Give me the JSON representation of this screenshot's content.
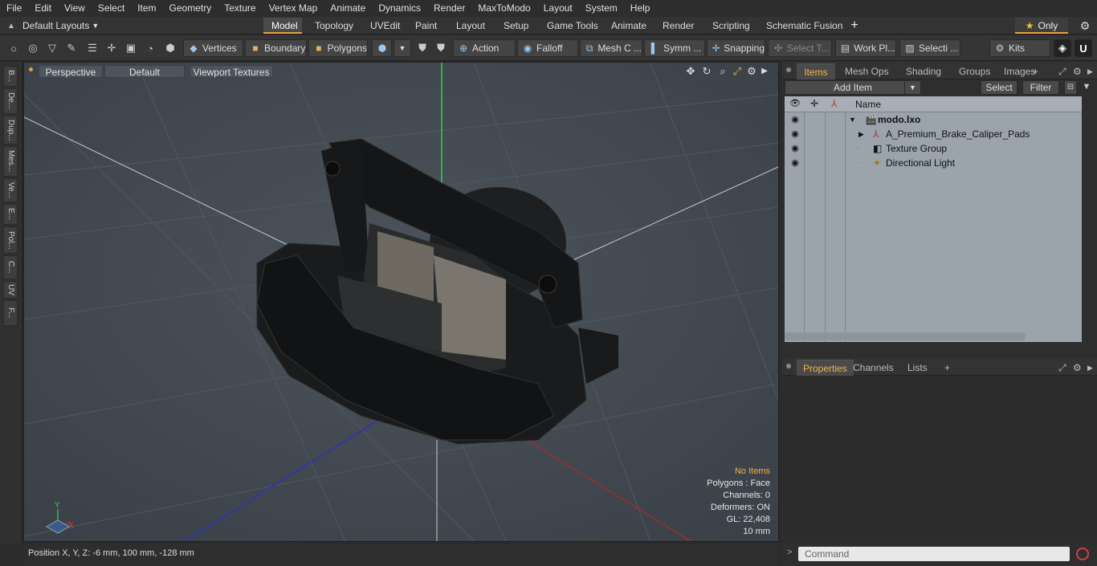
{
  "menu": [
    "File",
    "Edit",
    "View",
    "Select",
    "Item",
    "Geometry",
    "Texture",
    "Vertex Map",
    "Animate",
    "Dynamics",
    "Render",
    "MaxToModo",
    "Layout",
    "System",
    "Help"
  ],
  "layouts_label": "Default Layouts",
  "context_tabs": [
    "Model",
    "Topology",
    "UVEdit",
    "Paint",
    "Layout",
    "Setup",
    "Game Tools",
    "Animate",
    "Render",
    "Scripting",
    "Schematic Fusion"
  ],
  "active_tab": "Model",
  "only_label": "Only",
  "toolbar": {
    "vertices": "Vertices",
    "boundary": "Boundary",
    "polygons": "Polygons",
    "action": "Action",
    "falloff": "Falloff",
    "mesh": "Mesh C ...",
    "symm": "Symm ...",
    "snapping": "Snapping",
    "select_t": "Select T...",
    "work_pl": "Work Pl...",
    "selecti": "Selecti ...",
    "kits": "Kits"
  },
  "left_tabs": [
    "B...",
    "De...",
    "Dup...",
    "Mes...",
    "Ve...",
    "E...",
    "Pol...",
    "C...",
    "UV",
    "F..."
  ],
  "viewport": {
    "perspective": "Perspective",
    "default": "Default",
    "textures": "Viewport Textures",
    "info": {
      "no_items": "No Items",
      "polygons": "Polygons : Face",
      "channels": "Channels: 0",
      "deformers": "Deformers: ON",
      "gl": "GL: 22,408",
      "scale": "10 mm"
    },
    "axis_y": "Y",
    "axis_x": "X"
  },
  "status": "Position X, Y, Z:  -6 mm, 100 mm, -128 mm",
  "items_panel": {
    "tabs": [
      "Items",
      "Mesh Ops",
      "Shading",
      "Groups",
      "Images"
    ],
    "add_item": "Add Item",
    "select": "Select",
    "filter": "Filter",
    "name_header": "Name",
    "rows": [
      {
        "label": "modo.lxo"
      },
      {
        "label": "A_Premium_Brake_Caliper_Pads"
      },
      {
        "label": "Texture Group"
      },
      {
        "label": "Directional Light"
      }
    ]
  },
  "properties_panel": {
    "tabs": [
      "Properties",
      "Channels",
      "Lists"
    ]
  },
  "command_placeholder": "Command"
}
